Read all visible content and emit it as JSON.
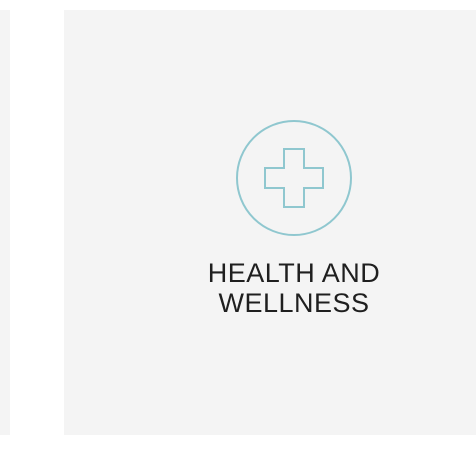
{
  "card": {
    "title_line1": "HEALTH AND",
    "title_line2": "WELLNESS",
    "icon": "medical-cross-icon",
    "accent_color": "#8fc7cf"
  }
}
